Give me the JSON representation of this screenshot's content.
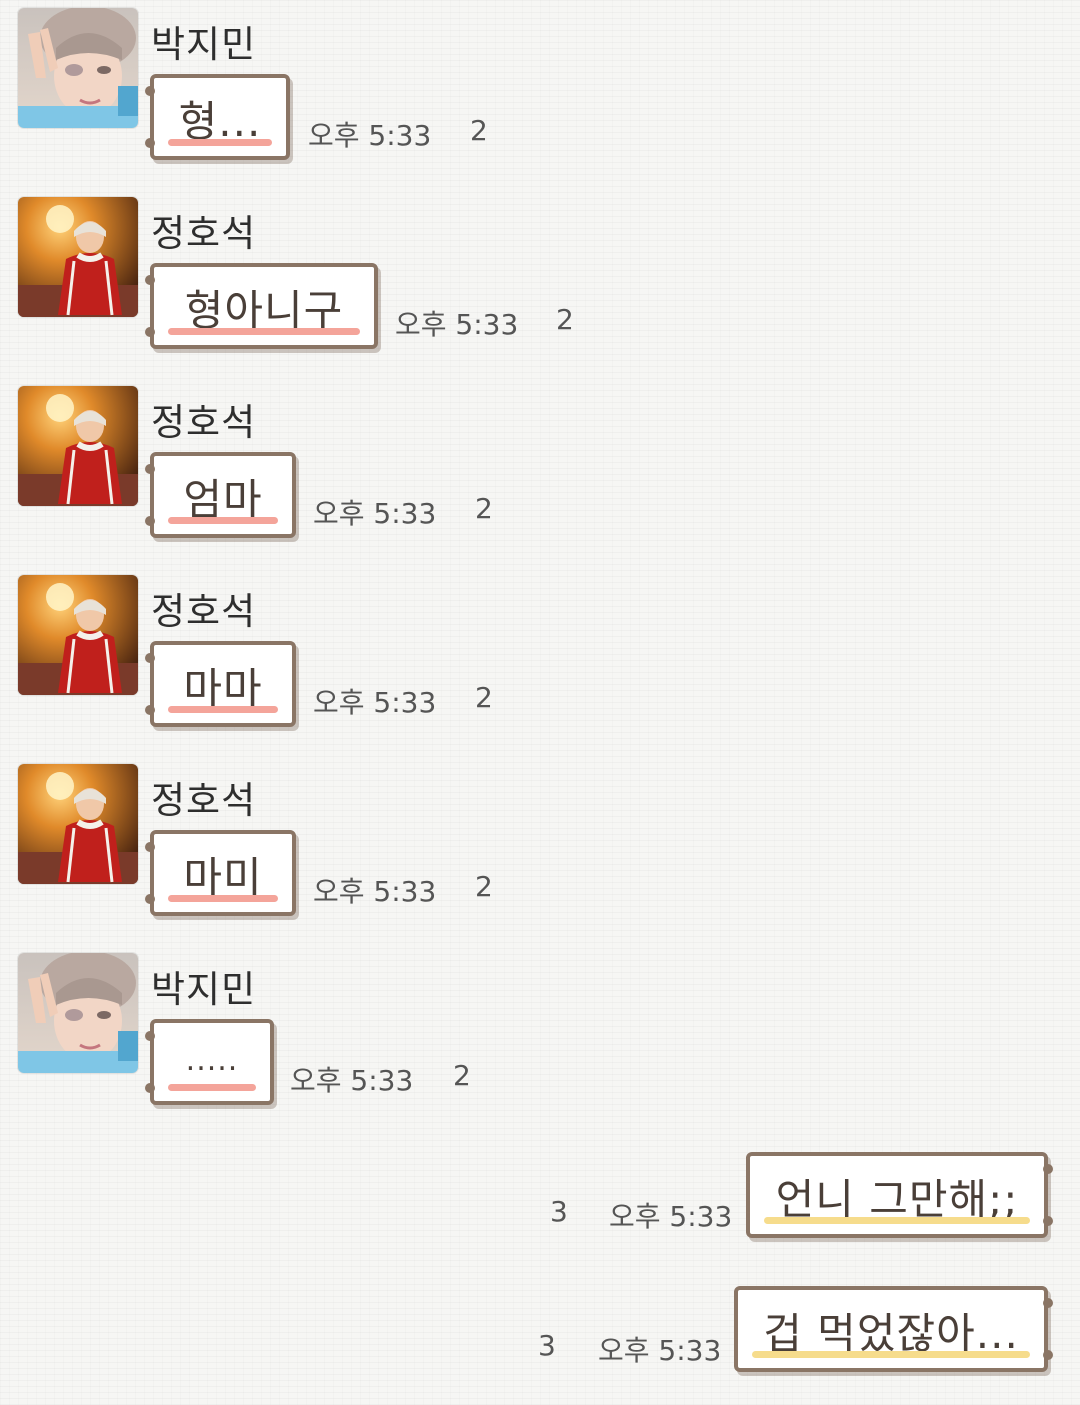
{
  "messages": [
    {
      "sender": "박지민",
      "text": "형...",
      "time": "오후 5:33",
      "unread": "2"
    },
    {
      "sender": "정호석",
      "text": "형아니구",
      "time": "오후 5:33",
      "unread": "2"
    },
    {
      "sender": "정호석",
      "text": "엄마",
      "time": "오후 5:33",
      "unread": "2"
    },
    {
      "sender": "정호석",
      "text": "마마",
      "time": "오후 5:33",
      "unread": "2"
    },
    {
      "sender": "정호석",
      "text": "마미",
      "time": "오후 5:33",
      "unread": "2"
    },
    {
      "sender": "박지민",
      "text": ".....",
      "time": "오후 5:33",
      "unread": "2"
    }
  ],
  "sent": [
    {
      "text": "언니 그만해;;",
      "time": "오후 5:33",
      "unread": "3"
    },
    {
      "text": "겁 먹었잖아...",
      "time": "오후 5:33",
      "unread": "3"
    }
  ],
  "colors": {
    "bubble_border": "#8a7565",
    "incoming_underline": "#f4a49a",
    "outgoing_underline": "#f6dc8c"
  }
}
